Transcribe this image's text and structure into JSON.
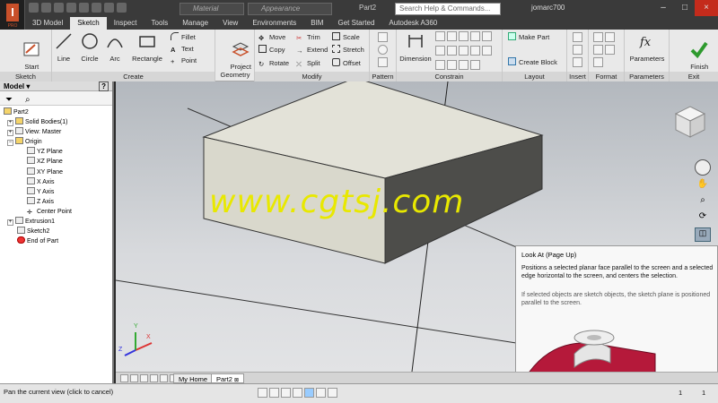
{
  "app": {
    "badge": "I",
    "version": "PRO",
    "document_title": "Part2"
  },
  "title_bar": {
    "material_dropdown": "Material",
    "appearance_dropdown": "Appearance",
    "search_placeholder": "Search Help & Commands...",
    "user": "jomarc700",
    "help": "?"
  },
  "ribbon_tabs": [
    "3D Model",
    "Sketch",
    "Inspect",
    "Tools",
    "Manage",
    "View",
    "Environments",
    "BIM",
    "Get Started",
    "Autodesk A360"
  ],
  "ribbon": {
    "sketch_panel": {
      "title": "Sketch",
      "start_label": "Start\n2D Sketch"
    },
    "create_panel": {
      "title": "Create",
      "line": "Line",
      "circle": "Circle",
      "arc": "Arc",
      "rectangle": "Rectangle",
      "fillet": "Fillet",
      "text": "Text",
      "point": "Point"
    },
    "project_geometry": "Project\nGeometry",
    "modify_panel": {
      "title": "Modify",
      "move": "Move",
      "copy": "Copy",
      "rotate": "Rotate",
      "trim": "Trim",
      "extend": "Extend",
      "split": "Split",
      "scale": "Scale",
      "stretch": "Stretch",
      "offset": "Offset"
    },
    "pattern_panel": {
      "title": "Pattern"
    },
    "constrain_panel": {
      "title": "Constrain",
      "dimension": "Dimension"
    },
    "layout_panel": {
      "title": "Layout",
      "make_part": "Make Part",
      "create_block": "Create Block"
    },
    "insert_panel": {
      "title": "Insert"
    },
    "format_panel": {
      "title": "Format"
    },
    "parameters_panel": {
      "title": "Parameters",
      "parameters": "Parameters"
    },
    "exit_panel": {
      "title": "Exit",
      "finish": "Finish\nSketch"
    }
  },
  "browser": {
    "title": "Model",
    "help": "?",
    "tree": [
      {
        "label": "Part2",
        "level": 0
      },
      {
        "label": "Solid Bodies(1)",
        "level": 1
      },
      {
        "label": "View: Master",
        "level": 1
      },
      {
        "label": "Origin",
        "level": 1
      },
      {
        "label": "YZ Plane",
        "level": 2
      },
      {
        "label": "XZ Plane",
        "level": 2
      },
      {
        "label": "XY Plane",
        "level": 2
      },
      {
        "label": "X Axis",
        "level": 2
      },
      {
        "label": "Y Axis",
        "level": 2
      },
      {
        "label": "Z Axis",
        "level": 2
      },
      {
        "label": "Center Point",
        "level": 2
      },
      {
        "label": "Extrusion1",
        "level": 1
      },
      {
        "label": "Sketch2",
        "level": 1
      },
      {
        "label": "End of Part",
        "level": 1
      }
    ]
  },
  "viewport": {
    "watermark": "www.cgtsj.com",
    "triad_x": "X",
    "triad_y": "Y",
    "triad_z": "Z"
  },
  "tooltip": {
    "title": "Look At (Page Up)",
    "body": "Positions a selected planar face parallel to the screen and a selected edge horizontal to the screen, and centers the selection.",
    "note": "If selected objects are sketch objects, the sketch plane is positioned parallel to the screen."
  },
  "doc_tabs": [
    "My Home",
    "Part2"
  ],
  "status": {
    "text": "Pan the current view (click to cancel)",
    "count_a": "1",
    "count_b": "1"
  },
  "colors": {
    "ribbon_bg": "#e9e9e9",
    "titlebar_bg": "#3a3a3a",
    "viewport_top": "#b3b8be",
    "watermark": "#e8e800",
    "part_red": "#b5193a"
  }
}
